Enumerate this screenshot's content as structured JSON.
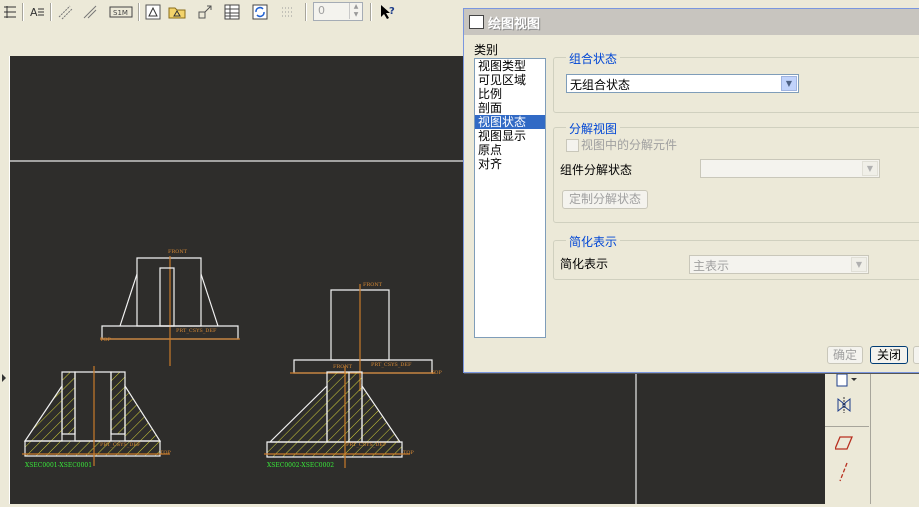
{
  "toolbar": {
    "icons": [
      "grid-icon",
      "text-style-icon",
      "dimension-icon",
      "slope-icon",
      "table-icon",
      "view-orient-icon",
      "folder-icon",
      "move-icon",
      "table-grid-icon",
      "refresh-icon",
      "dotted-grid-icon",
      "select-help-icon"
    ],
    "spin_value": "0"
  },
  "dialog": {
    "title": "绘图视图",
    "category_label": "类别",
    "categories": [
      "视图类型",
      "可见区域",
      "比例",
      "剖面",
      "视图状态",
      "视图显示",
      "原点",
      "对齐"
    ],
    "selected_category": "视图状态",
    "combo_state": {
      "title": "组合状态",
      "value": "无组合状态"
    },
    "explode": {
      "title": "分解视图",
      "checkbox_label": "视图中的分解元件",
      "state_label": "组件分解状态",
      "state_value": "",
      "custom_button": "定制分解状态"
    },
    "simplified": {
      "title": "简化表示",
      "label": "简化表示",
      "value": "主表示"
    },
    "buttons": {
      "ok": "确定",
      "close": "关闭"
    }
  },
  "drawing": {
    "labels": {
      "front_1": "FRONT",
      "csys_1": "PRT_CSYS_DEF",
      "top_1": "TOP",
      "front_2": "FRONT",
      "csys_2": "PRT_CSYS_DEF",
      "top_2": "TOP",
      "csys_3": "PRT_CSYS_DEF",
      "top_3": "TOP",
      "section_1": "XSEC0001-XSEC0001",
      "csys_4": "PRT_CSYS_DEF",
      "top_4": "TOP",
      "section_2": "XSEC0002-XSEC0002",
      "front_3": "FRONT"
    }
  }
}
